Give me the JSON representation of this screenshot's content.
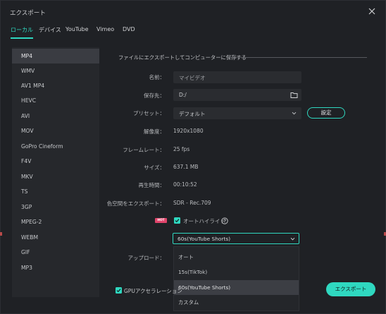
{
  "window": {
    "title": "エクスポート"
  },
  "tabs": [
    {
      "label": "ローカル",
      "active": true
    },
    {
      "label": "デバイス"
    },
    {
      "label": "YouTube"
    },
    {
      "label": "Vimeo"
    },
    {
      "label": "DVD"
    }
  ],
  "formats": [
    "MP4",
    "WMV",
    "AV1 MP4",
    "HEVC",
    "AVI",
    "MOV",
    "GoPro Cineform",
    "F4V",
    "MKV",
    "TS",
    "3GP",
    "MPEG-2",
    "WEBM",
    "GIF",
    "MP3"
  ],
  "selected_format": "MP4",
  "section_title": "ファイルにエクスポートしてコンピューターに保存する",
  "form": {
    "name_label": "名前：",
    "name_value": "マイビデオ",
    "save_to_label": "保存先：",
    "save_to_value": "D:/",
    "preset_label": "プリセット：",
    "preset_value": "デフォルト",
    "settings_button": "設定",
    "resolution_label": "解像度：",
    "resolution_value": "1920x1080",
    "framerate_label": "フレームレート：",
    "framerate_value": "25 fps",
    "size_label": "サイズ：",
    "size_value": "637.1 MB",
    "duration_label": "再生時間：",
    "duration_value": "00:10:52",
    "colorspace_label": "色空間をエクスポート：",
    "colorspace_value": "SDR - Rec.709",
    "hot_badge": "HOT",
    "auto_highlight_label": "オートハイライト",
    "upload_label": "アップロード：",
    "highlight_dropdown_value": "60s(YouTube Shorts)",
    "gpu_label": "GPUアクセラレーション"
  },
  "dropdown_options": [
    "オート",
    "15s(TikTok)",
    "60s(YouTube Shorts)",
    "カスタム"
  ],
  "dropdown_selected": "60s(YouTube Shorts)",
  "export_button": "エクスポート",
  "colors": {
    "accent": "#2fd8c0",
    "hot": "#e0446b",
    "background": "#1f2125",
    "panel": "#26282c"
  }
}
